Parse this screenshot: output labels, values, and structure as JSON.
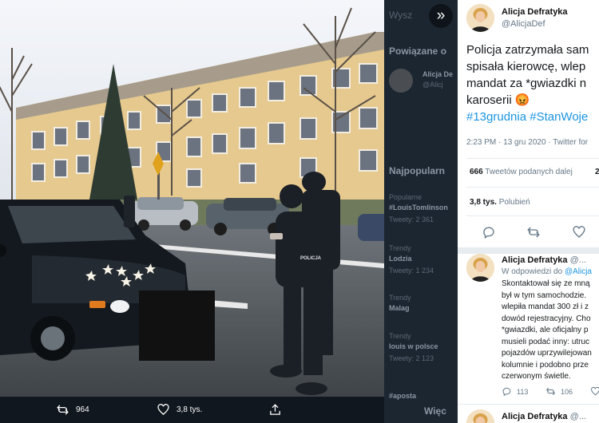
{
  "photo": {
    "sign_text": "POLICJA",
    "actions": {
      "retweets": "964",
      "likes": "3,8 tys."
    }
  },
  "sidebar": {
    "search_fragment": "Wysz",
    "related_title": "Powiązane o",
    "related_user": "Alicja De",
    "related_handle": "@Alicj",
    "trending_title": "Najpopularn",
    "trends": [
      {
        "context": "Popularne",
        "name": "#LouisTomlinson",
        "count": "Tweety: 2 361"
      },
      {
        "context": "Trendy",
        "name": "Lodzia",
        "count": "Tweety: 1 234"
      },
      {
        "context": "Trendy",
        "name": "Malag",
        "count": ""
      },
      {
        "context": "Trendy",
        "name": "louis w polsce",
        "count": "Tweety: 2 123"
      },
      {
        "context": "",
        "name": "#aposta",
        "count": ""
      }
    ],
    "bottom": "Więc"
  },
  "tweet": {
    "author": "Alicja Defratyka",
    "handle": "@AlicjaDef",
    "text_l1": "Policja zatrzymała sam",
    "text_l2": "spisała kierowcę, wlep",
    "text_l3": "mandat za *gwiazdki n",
    "text_l4": "karoserii",
    "emoji": "😡",
    "tags": "#13grudnia #StanWoje",
    "timestamp": "2:23 PM · 13 gru 2020 · Twitter for",
    "retweets_count": "666",
    "retweets_label": "Tweetów podanych dalej",
    "quotes_count": "2",
    "likes_count": "3,8 tys.",
    "likes_label": "Polubień"
  },
  "reply": {
    "author": "Alicja Defratyka",
    "handle": "@...",
    "reply_to_prefix": "W odpowiedzi do",
    "reply_to_handle": "@Alicja",
    "lines": [
      "Skontaktował się ze mną",
      "był w tym samochodzie.",
      "wlepiła mandat 300 zł i z",
      "dowód rejestracyjny. Cho",
      "*gwiazdki, ale oficjalny p",
      "musieli podać inny: utruc",
      "pojazdów uprzywilejowan",
      "kolumnie i podobno prze",
      "czerwonym świetle."
    ],
    "replies": "113",
    "retweets": "106"
  },
  "next": {
    "author": "Alicja Defratyka",
    "handle": "@..."
  },
  "colors": {
    "accent": "#1b95e0",
    "dark_bg": "#15202b"
  }
}
